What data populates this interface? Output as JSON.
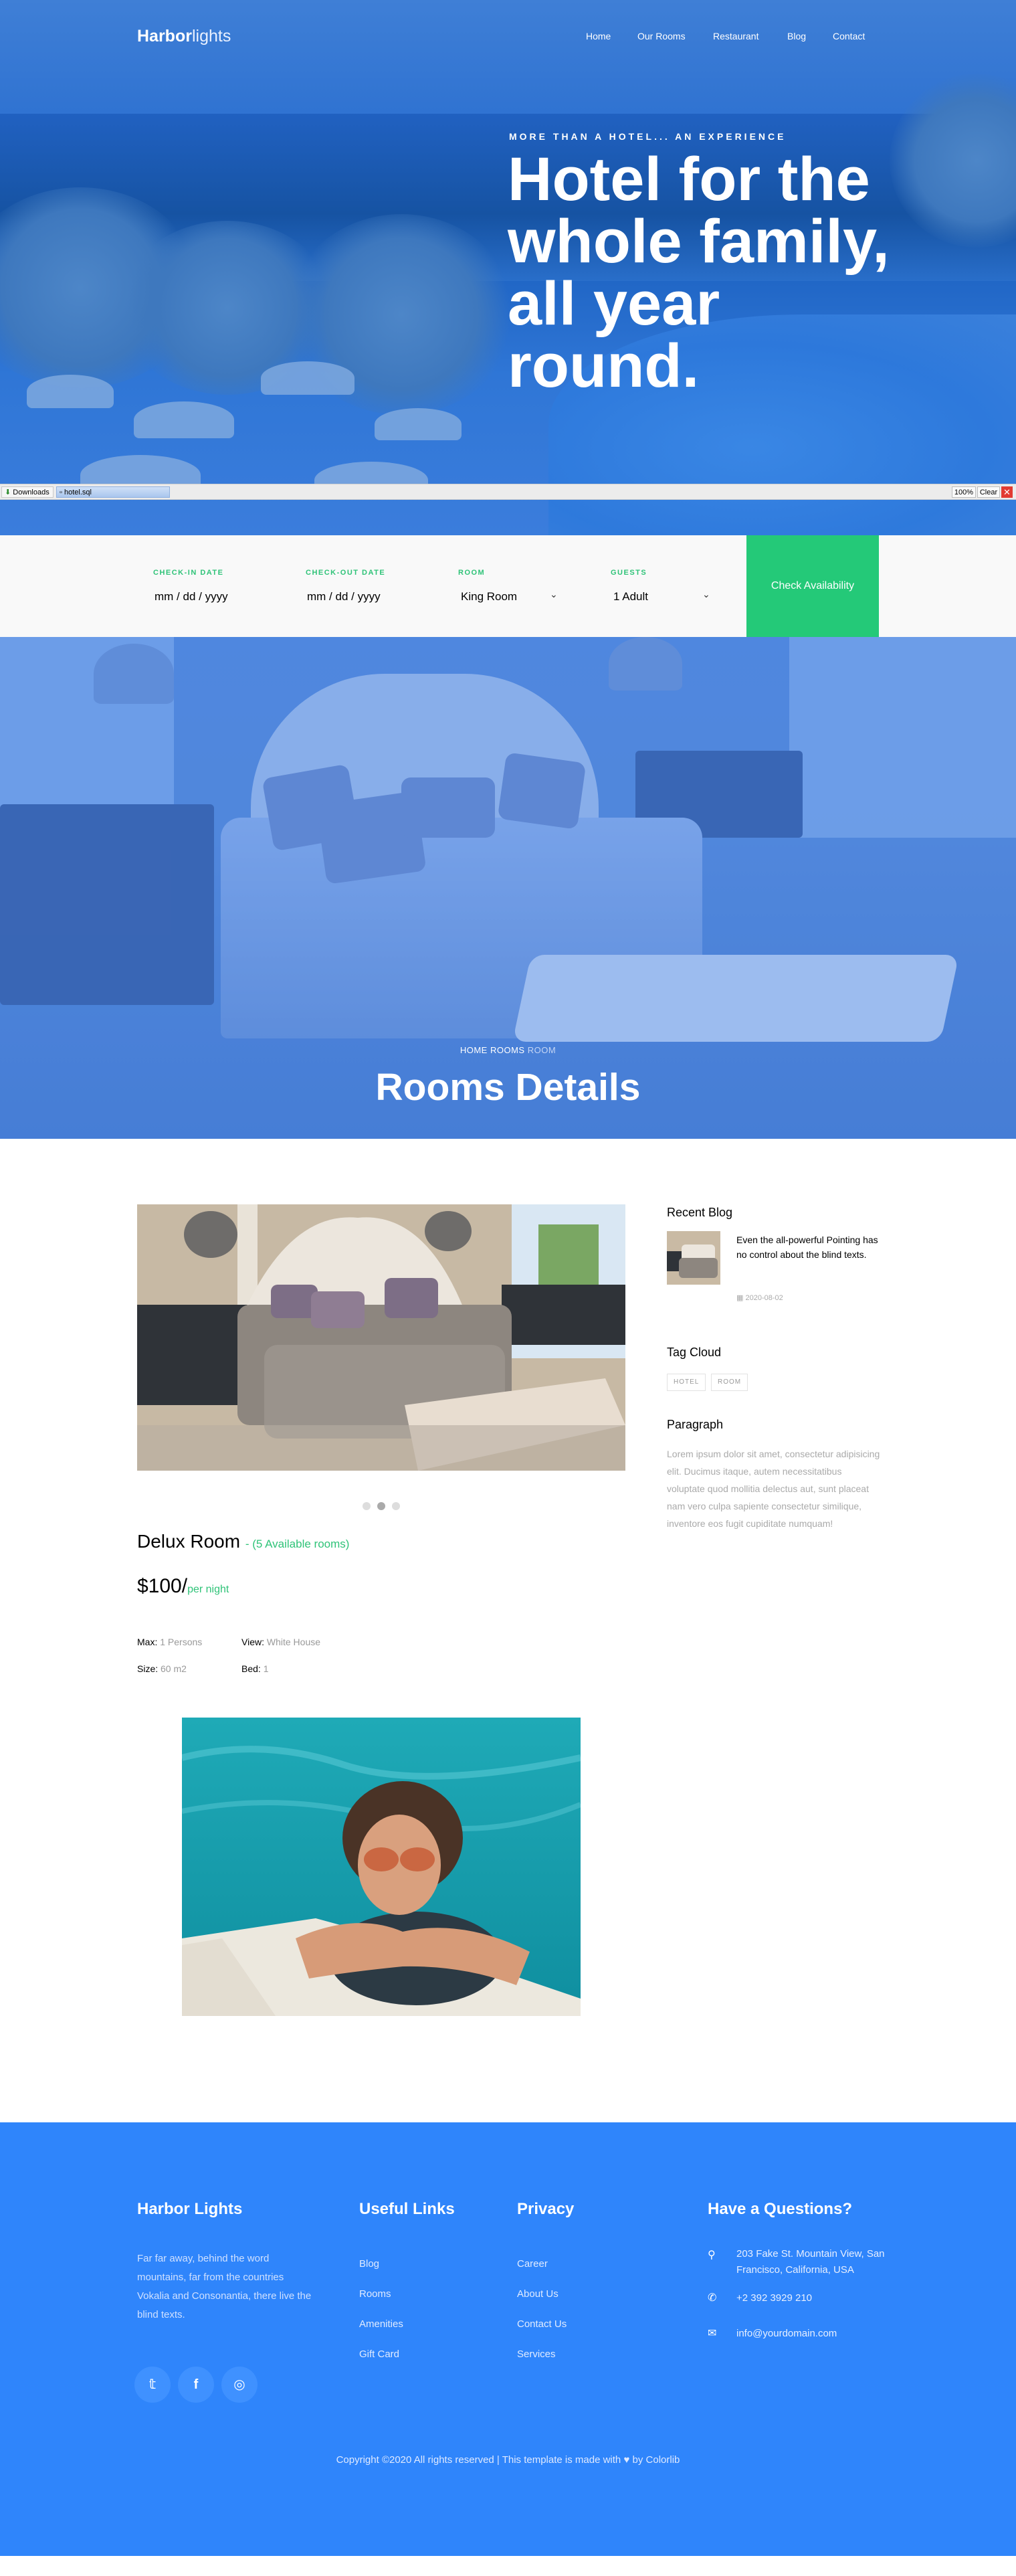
{
  "brand": {
    "part1": "Harbor",
    "part2": "lights"
  },
  "nav": [
    {
      "label": "Home"
    },
    {
      "label": "Our Rooms"
    },
    {
      "label": "Restaurant"
    },
    {
      "label": "Blog"
    },
    {
      "label": "Contact"
    }
  ],
  "hero": {
    "subtitle": "MORE THAN A HOTEL... AN EXPERIENCE",
    "title": "Hotel for the whole family, all year round."
  },
  "download_bar": {
    "downloads_label": "Downloads",
    "file_name": "hotel.sql",
    "zoom": "100%",
    "clear_label": "Clear",
    "close_glyph": "✕"
  },
  "booking": {
    "checkin_label": "CHECK-IN DATE",
    "checkin_value": "mm / dd / yyyy",
    "checkout_label": "CHECK-OUT DATE",
    "checkout_value": "mm / dd / yyyy",
    "room_label": "ROOM",
    "room_value": "King Room",
    "guests_label": "GUESTS",
    "guests_value": "1 Adult",
    "button_label": "Check Availability"
  },
  "rooms_hero": {
    "crumb_home": "HOME",
    "crumb_rooms": "ROOMS",
    "crumb_current": "ROOM",
    "title": "Rooms Details"
  },
  "room": {
    "name": "Delux Room",
    "availability": "- (5 Available rooms)",
    "price": "$100/",
    "price_unit": "per night",
    "specs": {
      "max_label": "Max:",
      "max_value": "1 Persons",
      "view_label": "View:",
      "view_value": "White House",
      "size_label": "Size:",
      "size_value": "60 m2",
      "bed_label": "Bed:",
      "bed_value": "1"
    }
  },
  "sidebar": {
    "recent_blog_heading": "Recent Blog",
    "blog_text": "Even the all-powerful Pointing has no control about the blind texts.",
    "blog_date": "2020-08-02",
    "tag_cloud_heading": "Tag Cloud",
    "tags": [
      "HOTEL",
      "ROOM"
    ],
    "paragraph_heading": "Paragraph",
    "paragraph_text": "Lorem ipsum dolor sit amet, consectetur adipisicing elit. Ducimus itaque, autem necessitatibus voluptate quod mollitia delectus aut, sunt placeat nam vero culpa sapiente consectetur similique, inventore eos fugit cupiditate numquam!"
  },
  "footer": {
    "col1_heading": "Harbor Lights",
    "col1_text": "Far far away, behind the word mountains, far from the countries Vokalia and Consonantia, there live the blind texts.",
    "col2_heading": "Useful Links",
    "col2_links": [
      "Blog",
      "Rooms",
      "Amenities",
      "Gift Card"
    ],
    "col3_heading": "Privacy",
    "col3_links": [
      "Career",
      "About Us",
      "Contact Us",
      "Services"
    ],
    "col4_heading": "Have a Questions?",
    "address": "203 Fake St. Mountain View, San Francisco, California, USA",
    "phone": "+2 392 3929 210",
    "email": "info@yourdomain.com",
    "social": [
      "twitter-icon",
      "facebook-icon",
      "instagram-icon"
    ],
    "copyright_prefix": "Copyright ©2020 All rights reserved | This template is made with",
    "copyright_suffix": "by Colorlib"
  }
}
